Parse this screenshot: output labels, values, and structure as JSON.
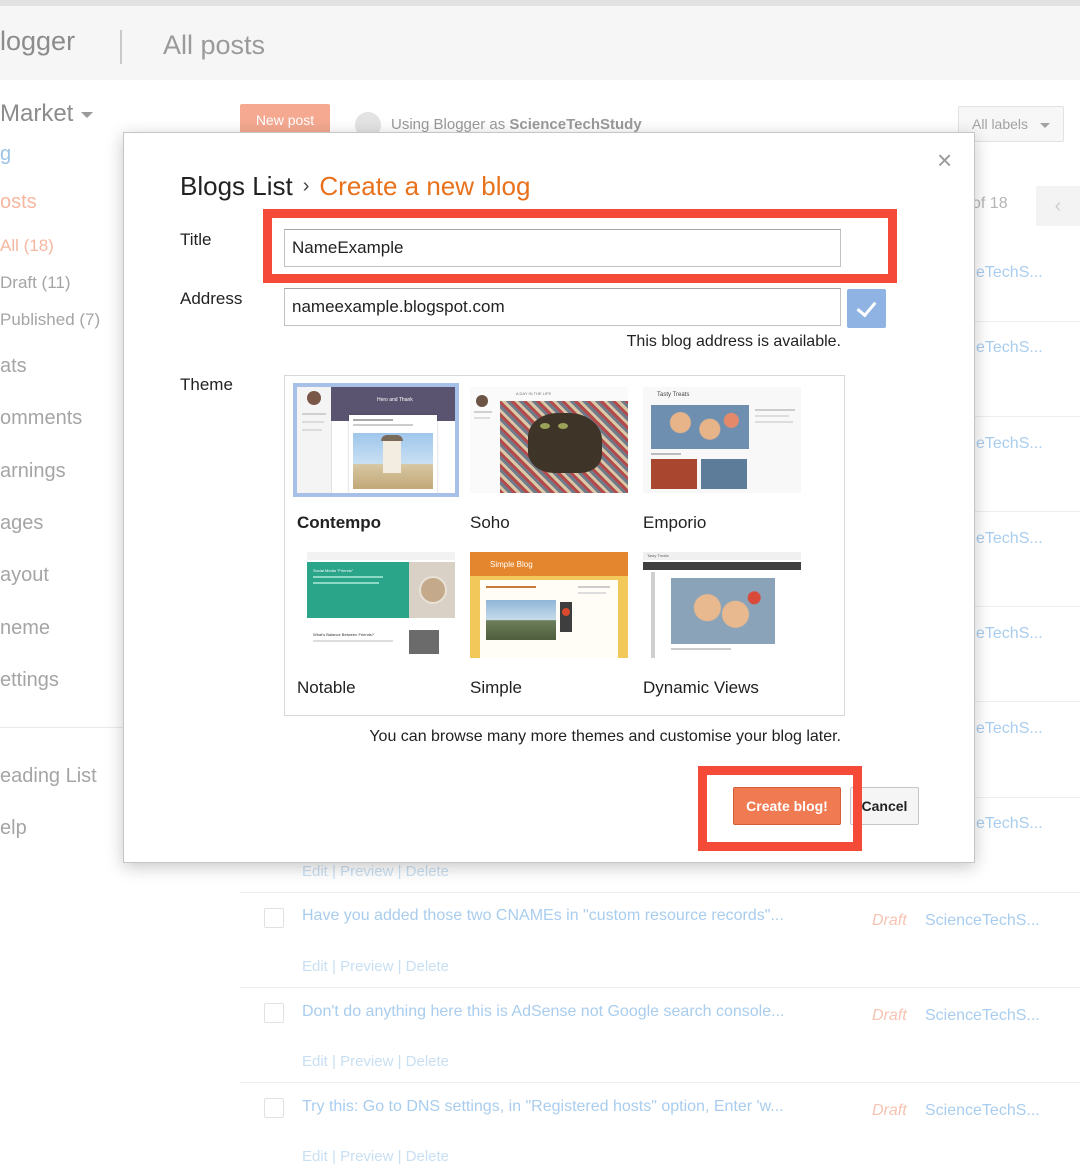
{
  "app": {
    "logo": "logger",
    "section": "All posts"
  },
  "sidebar": {
    "blog_name": "Market",
    "items": [
      {
        "label": "g"
      },
      {
        "label": "osts"
      },
      {
        "label": "All (18)"
      },
      {
        "label": "Draft (11)"
      },
      {
        "label": "Published (7)"
      },
      {
        "label": "ats"
      },
      {
        "label": "omments"
      },
      {
        "label": "arnings"
      },
      {
        "label": "ages"
      },
      {
        "label": "ayout"
      },
      {
        "label": "neme"
      },
      {
        "label": "ettings"
      },
      {
        "label": "eading List"
      },
      {
        "label": "elp"
      }
    ]
  },
  "toolbar": {
    "new_post": "New post",
    "using_prefix": "Using Blogger as",
    "account": "ScienceTechStudy",
    "labels_dropdown": "All labels",
    "page_count": "of 18"
  },
  "posts": {
    "author_truncated": "eTechS...",
    "author_full": "ScienceTechS...",
    "actions": "Edit | Preview | Delete",
    "rows": [
      {
        "title": "Have you added those two CNAMEs in \"custom resource records\"...",
        "status": "Draft"
      },
      {
        "title": "Don't do anything here this is AdSense not Google search console...",
        "status": "Draft"
      },
      {
        "title": "Try this: Go to DNS settings, in \"Registered hosts\" option, Enter 'w...",
        "status": "Draft"
      }
    ]
  },
  "dialog": {
    "breadcrumb_root": "Blogs List",
    "breadcrumb_sep": "›",
    "breadcrumb_current": "Create a new blog",
    "title_label": "Title",
    "title_value": "NameExample",
    "address_label": "Address",
    "address_value": "nameexample.blogspot.com",
    "address_status": "This blog address is available.",
    "theme_label": "Theme",
    "themes": [
      {
        "name": "Contempo",
        "selected": true
      },
      {
        "name": "Soho",
        "selected": false
      },
      {
        "name": "Emporio",
        "selected": false
      },
      {
        "name": "Notable",
        "selected": false
      },
      {
        "name": "Simple",
        "selected": false
      },
      {
        "name": "Dynamic Views",
        "selected": false
      }
    ],
    "thumb_text": {
      "contempo_header": "Hero and Thank",
      "soho_header": "A DAY IN THE LIFE",
      "emporio_header": "Tasty Treats",
      "notable_header": "Social Media \"Friends\"",
      "notable_sub": "What's Balance Between Friends?",
      "simple_header": "Simple Blog",
      "dynamic_header": "Tasty Treats"
    },
    "browse_note": "You can browse many more themes and customise your blog later.",
    "create_button": "Create blog!",
    "cancel_button": "Cancel",
    "close_icon": "×"
  },
  "colors": {
    "accent_orange": "#e8711c",
    "create_button": "#f07a51",
    "annotation_red": "#f44a37",
    "check_button": "#8fb3e3",
    "selected_theme_border": "#a7c0e8"
  }
}
